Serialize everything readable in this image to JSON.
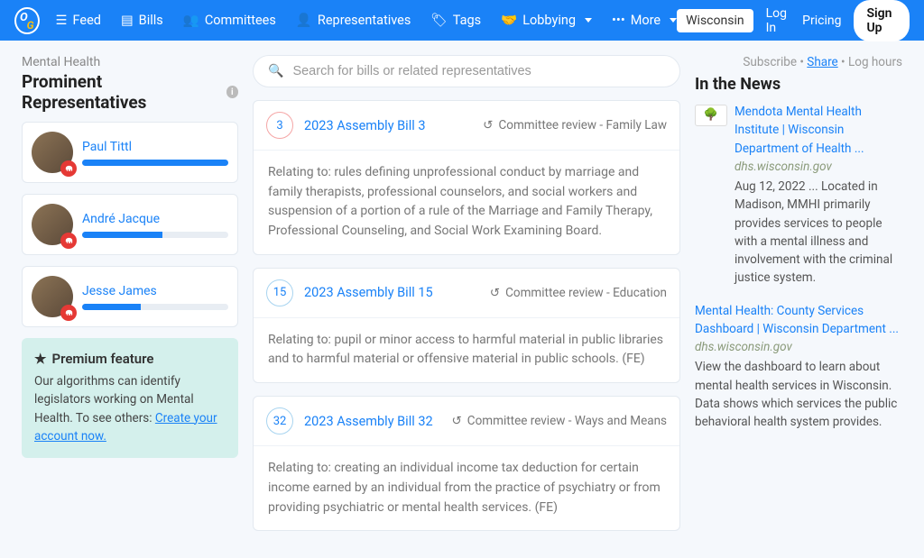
{
  "nav": {
    "feed": "Feed",
    "bills": "Bills",
    "committees": "Committees",
    "reps": "Representatives",
    "tags": "Tags",
    "lobbying": "Lobbying",
    "more": "More",
    "state": "Wisconsin",
    "login": "Log In",
    "pricing": "Pricing",
    "signup": "Sign Up"
  },
  "tag": "Mental Health",
  "section_title": "Prominent Representatives",
  "reps": [
    {
      "name": "Paul Tittl",
      "bar": 100
    },
    {
      "name": "André Jacque",
      "bar": 55
    },
    {
      "name": "Jesse James",
      "bar": 40
    }
  ],
  "premium": {
    "title": "Premium feature",
    "text": "Our algorithms can identify legislators working on Mental Health. To see others: ",
    "link": "Create your account now."
  },
  "search_placeholder": "Search for bills or related representatives",
  "bills": [
    {
      "num": "3",
      "title": "2023 Assembly Bill 3",
      "status": "Committee review - Family Law",
      "body": "Relating to: rules defining unprofessional conduct by marriage and family therapists, professional counselors, and social workers and suspension of a portion of a rule of the Marriage and Family Therapy, Professional Counseling, and Social Work Examining Board.",
      "ring": "pink"
    },
    {
      "num": "15",
      "title": "2023 Assembly Bill 15",
      "status": "Committee review - Education",
      "body": "Relating to: pupil or minor access to harmful material in public libraries and to harmful material or offensive material in public schools. (FE)",
      "ring": "blue"
    },
    {
      "num": "32",
      "title": "2023 Assembly Bill 32",
      "status": "Committee review - Ways and Means",
      "body": "Relating to: creating an individual income tax deduction for certain income earned by an individual from the practice of psychiatry or from providing psychiatric or mental health services. (FE)",
      "ring": "blue"
    }
  ],
  "toplinks": {
    "subscribe": "Subscribe",
    "share": "Share",
    "log": "Log hours"
  },
  "news_title": "In the News",
  "news": [
    {
      "title": "Mendota Mental Health Institute | Wisconsin Department of Health ...",
      "src": "dhs.wisconsin.gov",
      "desc": "Aug 12, 2022 ... Located in Madison, MMHI primarily provides services to people with a mental illness and involvement with the criminal justice system."
    },
    {
      "title": "Mental Health: County Services Dashboard | Wisconsin Department ...",
      "src": "dhs.wisconsin.gov",
      "desc": "View the dashboard to learn about mental health services in Wisconsin. Data shows which services the public behavioral health system provides."
    }
  ]
}
